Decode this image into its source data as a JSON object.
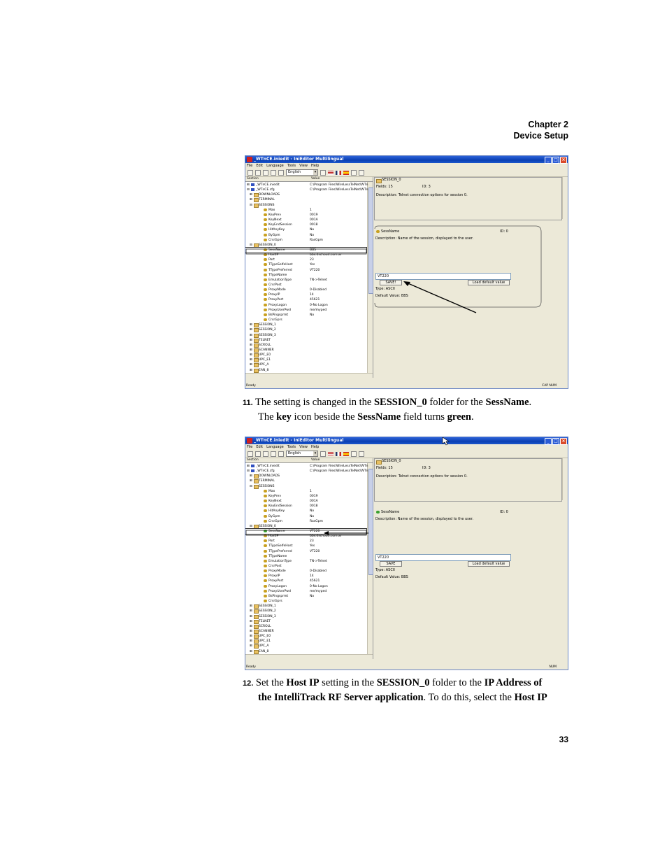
{
  "header": {
    "chapter": "Chapter 2",
    "section": "Device Setup"
  },
  "screenshot1": {
    "title": "_WTnCE.iniedit - IniEditor Multilingual",
    "menu": [
      "File",
      "Edit",
      "Language",
      "Tools",
      "View",
      "Help"
    ],
    "language": "English",
    "tree_headers": {
      "section": "Section",
      "value": "Value"
    },
    "tree": [
      {
        "name": "_WTnCE.iniedit",
        "value": "C:\\Program Files\\WireLessTelNet\\WTn",
        "indent": 0,
        "icon": "file"
      },
      {
        "name": "_WTnCE.cfg",
        "value": "C:\\Program Files\\WireLessTelNet\\WTn",
        "indent": 0,
        "icon": "file"
      },
      {
        "name": "DOWNLOADS",
        "value": "",
        "indent": 1,
        "icon": "folder"
      },
      {
        "name": "TERMINAL",
        "value": "",
        "indent": 1,
        "icon": "folder"
      },
      {
        "name": "SESSIONS",
        "value": "",
        "indent": 1,
        "icon": "folder"
      },
      {
        "name": "Max",
        "value": "1",
        "indent": 2,
        "icon": "key"
      },
      {
        "name": "KeyPrev",
        "value": "0019",
        "indent": 2,
        "icon": "key"
      },
      {
        "name": "KeyNext",
        "value": "001A",
        "indent": 2,
        "icon": "key"
      },
      {
        "name": "KeyEndSession",
        "value": "0018",
        "indent": 2,
        "icon": "key"
      },
      {
        "name": "HitAnyKey",
        "value": "No",
        "indent": 2,
        "icon": "key"
      },
      {
        "name": "ByGpm",
        "value": "No",
        "indent": 2,
        "icon": "key"
      },
      {
        "name": "CrsrGpm",
        "value": "RasGpm",
        "indent": 2,
        "icon": "key"
      },
      {
        "name": "SESSION_0",
        "value": "",
        "indent": 1,
        "icon": "folder"
      },
      {
        "name": "SessName",
        "value": "BBS",
        "indent": 2,
        "icon": "key",
        "selected": true
      },
      {
        "name": "HostIP",
        "value": "bbs.dschoud.com.ar",
        "indent": 2,
        "icon": "key"
      },
      {
        "name": "Port",
        "value": "23",
        "indent": 2,
        "icon": "key"
      },
      {
        "name": "TTypeSelfeHost",
        "value": "Yes",
        "indent": 2,
        "icon": "key"
      },
      {
        "name": "TTypePreferred",
        "value": "VT220",
        "indent": 2,
        "icon": "key"
      },
      {
        "name": "TTypeName",
        "value": "",
        "indent": 2,
        "icon": "key"
      },
      {
        "name": "EmulationType",
        "value": "TN->Telnet",
        "indent": 2,
        "icon": "key"
      },
      {
        "name": "CrsrPost",
        "value": "",
        "indent": 2,
        "icon": "key"
      },
      {
        "name": "ProxyMode",
        "value": "0-Disabled",
        "indent": 2,
        "icon": "key"
      },
      {
        "name": "ProxyIP",
        "value": "14",
        "indent": 2,
        "icon": "key"
      },
      {
        "name": "ProxyPort",
        "value": "45621",
        "indent": 2,
        "icon": "key"
      },
      {
        "name": "ProxyLogon",
        "value": "0-No Logon",
        "indent": 2,
        "icon": "key"
      },
      {
        "name": "ProxyUserPwd",
        "value": "me/myped",
        "indent": 2,
        "icon": "key"
      },
      {
        "name": "BsPingsprmt",
        "value": "No",
        "indent": 2,
        "icon": "key"
      },
      {
        "name": "CrsrGprs",
        "value": "",
        "indent": 2,
        "icon": "key"
      },
      {
        "name": "SESSION_1",
        "value": "",
        "indent": 1,
        "icon": "folder"
      },
      {
        "name": "SESSION_2",
        "value": "",
        "indent": 1,
        "icon": "folder"
      },
      {
        "name": "SESSION_3",
        "value": "",
        "indent": 1,
        "icon": "folder"
      },
      {
        "name": "TELNET",
        "value": "",
        "indent": 1,
        "icon": "folder"
      },
      {
        "name": "SCROLL",
        "value": "",
        "indent": 1,
        "icon": "folder"
      },
      {
        "name": "SCANNER",
        "value": "",
        "indent": 1,
        "icon": "folder"
      },
      {
        "name": "UPC_E0",
        "value": "",
        "indent": 1,
        "icon": "folder"
      },
      {
        "name": "UPC_E1",
        "value": "",
        "indent": 1,
        "icon": "folder"
      },
      {
        "name": "UPC_A",
        "value": "",
        "indent": 1,
        "icon": "folder"
      },
      {
        "name": "EAN_8",
        "value": "",
        "indent": 1,
        "icon": "folder"
      }
    ],
    "top_panel": {
      "section": "SESSION_0",
      "fields": "Fields: 15",
      "id": "ID: 3",
      "description": "Description: Telnet connection options for session 0."
    },
    "detail": {
      "key": "SessName",
      "id": "ID: 0",
      "description": "Description: Name of the session, displayed to the user.",
      "input_value": "VT220",
      "save_label": "SAVE!",
      "load_default_label": "Load default value",
      "type": "Type: ASCII",
      "default_value": "Default Value: BBS"
    },
    "status_left": "Ready",
    "status_right": "CAP NUM"
  },
  "step11": {
    "number": "11.",
    "text_a": " The setting is changed in the ",
    "b1": "SESSION_0",
    "text_b": " folder for the ",
    "b2": "SessName",
    "text_c": ".",
    "text_d": "The ",
    "b3": "key",
    "text_e": " icon beside the ",
    "b4": "SessName",
    "text_f": " field turns ",
    "b5": "green",
    "text_g": "."
  },
  "screenshot2": {
    "title": "_WTnCE.iniedit - IniEditor Multilingual",
    "menu": [
      "File",
      "Edit",
      "Language",
      "Tools",
      "View",
      "Help"
    ],
    "language": "English",
    "tree_headers": {
      "section": "Section",
      "value": "Value"
    },
    "tree": [
      {
        "name": "_WTnCE.iniedit",
        "value": "C:\\Program Files\\WireLessTelNet\\WTn",
        "indent": 0,
        "icon": "file"
      },
      {
        "name": "_WTnCE.cfg",
        "value": "C:\\Program Files\\WireLessTelNet\\WTn",
        "indent": 0,
        "icon": "file"
      },
      {
        "name": "DOWNLOADS",
        "value": "",
        "indent": 1,
        "icon": "folder"
      },
      {
        "name": "TERMINAL",
        "value": "",
        "indent": 1,
        "icon": "folder"
      },
      {
        "name": "SESSIONS",
        "value": "",
        "indent": 1,
        "icon": "folder"
      },
      {
        "name": "Max",
        "value": "1",
        "indent": 2,
        "icon": "key"
      },
      {
        "name": "KeyPrev",
        "value": "0019",
        "indent": 2,
        "icon": "key"
      },
      {
        "name": "KeyNext",
        "value": "001A",
        "indent": 2,
        "icon": "key"
      },
      {
        "name": "KeyEndSession",
        "value": "0018",
        "indent": 2,
        "icon": "key"
      },
      {
        "name": "HitAnyKey",
        "value": "No",
        "indent": 2,
        "icon": "key"
      },
      {
        "name": "ByGpm",
        "value": "No",
        "indent": 2,
        "icon": "key"
      },
      {
        "name": "CrsrGpm",
        "value": "RasGpm",
        "indent": 2,
        "icon": "key"
      },
      {
        "name": "SESSION_0",
        "value": "",
        "indent": 1,
        "icon": "folder"
      },
      {
        "name": "SessName",
        "value": "VT220",
        "indent": 2,
        "icon": "keyg",
        "selected": true
      },
      {
        "name": "HostIP",
        "value": "bbs.dschoud.com.ar",
        "indent": 2,
        "icon": "key"
      },
      {
        "name": "Port",
        "value": "23",
        "indent": 2,
        "icon": "key"
      },
      {
        "name": "TTypeSelfeHost",
        "value": "Yes",
        "indent": 2,
        "icon": "key"
      },
      {
        "name": "TTypePreferred",
        "value": "VT220",
        "indent": 2,
        "icon": "key"
      },
      {
        "name": "TTypeName",
        "value": "",
        "indent": 2,
        "icon": "key"
      },
      {
        "name": "EmulationType",
        "value": "TN->Telnet",
        "indent": 2,
        "icon": "key"
      },
      {
        "name": "CrsrPost",
        "value": "",
        "indent": 2,
        "icon": "key"
      },
      {
        "name": "ProxyMode",
        "value": "0-Disabled",
        "indent": 2,
        "icon": "key"
      },
      {
        "name": "ProxyIP",
        "value": "14",
        "indent": 2,
        "icon": "key"
      },
      {
        "name": "ProxyPort",
        "value": "45621",
        "indent": 2,
        "icon": "key"
      },
      {
        "name": "ProxyLogon",
        "value": "0-No Logon",
        "indent": 2,
        "icon": "key"
      },
      {
        "name": "ProxyUserPwd",
        "value": "me/myped",
        "indent": 2,
        "icon": "key"
      },
      {
        "name": "BsPingsprmt",
        "value": "No",
        "indent": 2,
        "icon": "key"
      },
      {
        "name": "CrsrGprs",
        "value": "",
        "indent": 2,
        "icon": "key"
      },
      {
        "name": "SESSION_1",
        "value": "",
        "indent": 1,
        "icon": "folder"
      },
      {
        "name": "SESSION_2",
        "value": "",
        "indent": 1,
        "icon": "folder"
      },
      {
        "name": "SESSION_3",
        "value": "",
        "indent": 1,
        "icon": "folder"
      },
      {
        "name": "TELNET",
        "value": "",
        "indent": 1,
        "icon": "folder"
      },
      {
        "name": "SCROLL",
        "value": "",
        "indent": 1,
        "icon": "folder"
      },
      {
        "name": "SCANNER",
        "value": "",
        "indent": 1,
        "icon": "folder"
      },
      {
        "name": "UPC_E0",
        "value": "",
        "indent": 1,
        "icon": "folder"
      },
      {
        "name": "UPC_E1",
        "value": "",
        "indent": 1,
        "icon": "folder"
      },
      {
        "name": "UPC_A",
        "value": "",
        "indent": 1,
        "icon": "folder"
      },
      {
        "name": "EAN_8",
        "value": "",
        "indent": 1,
        "icon": "folder"
      }
    ],
    "top_panel": {
      "section": "SESSION_0",
      "fields": "Fields: 15",
      "id": "ID: 3",
      "description": "Description: Telnet connection options for session 0."
    },
    "detail": {
      "key": "SessName",
      "id": "ID: 0",
      "description": "Description: Name of the session, displayed to the user.",
      "input_value": "VT220",
      "save_label": "SAVE",
      "load_default_label": "Load default value",
      "type": "Type: ASCII",
      "default_value": "Default Value: BBS"
    },
    "status_left": "Ready",
    "status_right": "NUM"
  },
  "step12": {
    "number": "12.",
    "text_a": " Set the ",
    "b1": "Host IP",
    "text_b": " setting in the ",
    "b2": "SESSION_0",
    "text_c": " folder to the ",
    "b3": "IP Address of",
    "b4": "the IntelliTrack RF Server application",
    "text_d": ". To do this, select the ",
    "b5": "Host IP"
  },
  "page_number": "33"
}
